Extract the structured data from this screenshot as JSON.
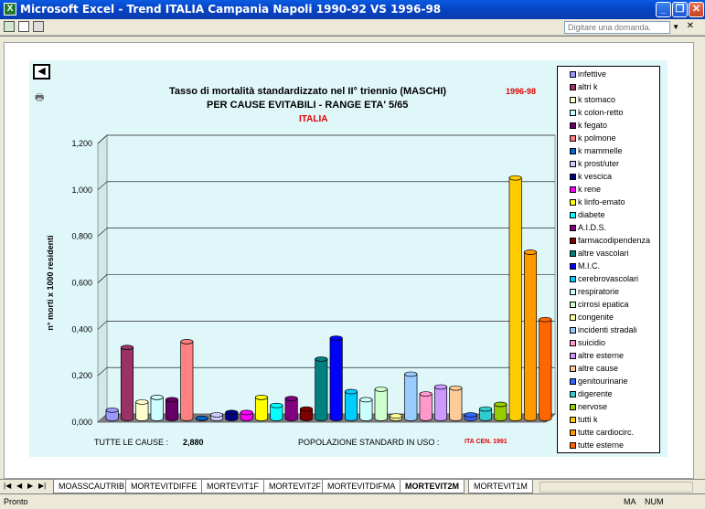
{
  "window": {
    "title": "Microsoft Excel - Trend ITALIA Campania Napoli 1990-92 VS 1996-98",
    "ask_placeholder": "Digitare una domanda."
  },
  "chart": {
    "title_line1": "Tasso di mortalità standardizzato nel II° triennio (MASCHI)",
    "title_line2": "PER CAUSE EVITABILI - RANGE ETA' 5/65",
    "region": "ITALIA",
    "period": "1996-98",
    "footer_label_total": "TUTTE LE CAUSE :",
    "footer_value_total": "2,880",
    "footer_label_pop": "POPOLAZIONE STANDARD IN USO :",
    "footer_value_pop": "ITA CEN. 1991"
  },
  "chart_data": {
    "type": "bar",
    "title": "Tasso di mortalità standardizzato nel II° triennio (MASCHI)",
    "xlabel": "",
    "ylabel": "n° morti x 1000 residenti",
    "ylim": [
      0,
      1.2
    ],
    "yticks": [
      "0,000",
      "0,200",
      "0,400",
      "0,600",
      "0,800",
      "1,000",
      "1,200"
    ],
    "grid": true,
    "legend": "right",
    "categories": [
      "infettive",
      "altri k",
      "k stomaco",
      "k colon-retto",
      "k fegato",
      "k polmone",
      "k mammelle",
      "k prost/uter",
      "k vescica",
      "k rene",
      "k linfo-emato",
      "diabete",
      "A.I.D.S.",
      "farmacodipendenza",
      "altre vascolari",
      "M.I.C.",
      "cerebrovascolari",
      "respiratorie",
      "cirrosi epatica",
      "congenite",
      "incidenti stradali",
      "suicidio",
      "altre esterne",
      "altre cause",
      "genitourinarie",
      "digerente",
      "nervose",
      "tutti k",
      "tutte cardiocirc.",
      "tutte esterne"
    ],
    "values": [
      0.04,
      0.31,
      0.075,
      0.095,
      0.085,
      0.335,
      0.005,
      0.02,
      0.03,
      0.03,
      0.095,
      0.06,
      0.09,
      0.045,
      0.26,
      0.35,
      0.12,
      0.085,
      0.13,
      0.015,
      0.195,
      0.11,
      0.14,
      0.135,
      0.02,
      0.045,
      0.065,
      1.04,
      0.72,
      0.43
    ],
    "colors": [
      "#9999ff",
      "#993366",
      "#ffffcc",
      "#ccffff",
      "#660066",
      "#ff8080",
      "#0066cc",
      "#ccccff",
      "#000080",
      "#ff00ff",
      "#ffff00",
      "#00ffff",
      "#800080",
      "#800000",
      "#008080",
      "#0000ff",
      "#00ccff",
      "#ccffff",
      "#ccffcc",
      "#ffff99",
      "#99ccff",
      "#ff99cc",
      "#cc99ff",
      "#ffcc99",
      "#3366ff",
      "#33cccc",
      "#99cc00",
      "#ffcc00",
      "#ff9900",
      "#ff6600"
    ]
  },
  "sheets": {
    "tabs": [
      "MOASSCAUTRIB",
      "MORTEVITDIFFE",
      "MORTEVIT1F",
      "MORTEVIT2F",
      "MORTEVITDIFMA",
      "MORTEVIT2M",
      "MORTEVIT1M"
    ],
    "active": "MORTEVIT2M"
  },
  "status": {
    "left": "Pronto",
    "right": "MA    NUM"
  }
}
